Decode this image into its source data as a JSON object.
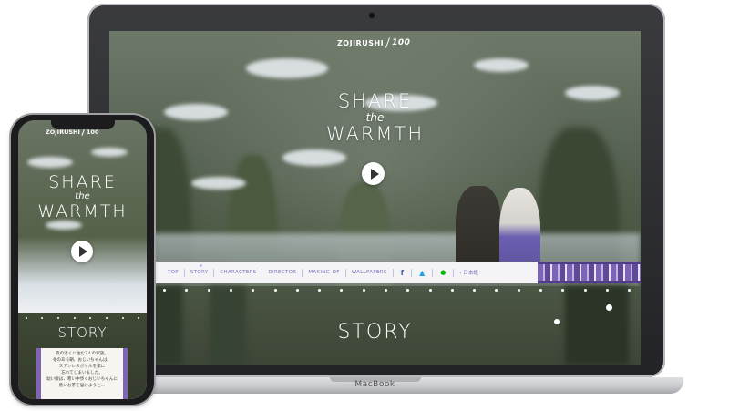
{
  "desktop": {
    "logo": {
      "brand": "ZOJIRUSHI",
      "anniversary": "100"
    },
    "hero": {
      "line1": "SHARE",
      "line2": "the",
      "line3": "WARMTH"
    },
    "nav": {
      "items": [
        {
          "label": "TOP",
          "active": false
        },
        {
          "label": "STORY",
          "active": true
        },
        {
          "label": "CHARACTERS",
          "active": false
        },
        {
          "label": "DIRECTOR",
          "active": false
        },
        {
          "label": "MAKING-OF",
          "active": false
        },
        {
          "label": "WALLPAPERS",
          "active": false
        }
      ],
      "social": {
        "facebook": "f",
        "twitter": "🐦",
        "line": "LINE"
      },
      "lang": "› 日本語"
    },
    "story_heading": "STORY",
    "device_brand": "MacBook"
  },
  "mobile": {
    "logo": {
      "brand": "ZOJIRUSHI",
      "anniversary": "100"
    },
    "hero": {
      "line1": "SHARE",
      "line2": "the",
      "line3": "WARMTH"
    },
    "story_heading": "STORY",
    "story_text": [
      "森の近くに住む3人の家族。",
      "冬のある朝、おじいちゃんは、",
      "ステンレスボトルを家に",
      "忘れてしまいました。",
      "幼い娘は、寒い中歩くおじいちゃんに",
      "熱いお茶を届けようと…"
    ]
  },
  "colors": {
    "accent_purple": "#7d64b5",
    "nav_text": "#7a6bb8",
    "facebook": "#3b5998",
    "twitter": "#1da1f2",
    "line": "#00b900"
  }
}
